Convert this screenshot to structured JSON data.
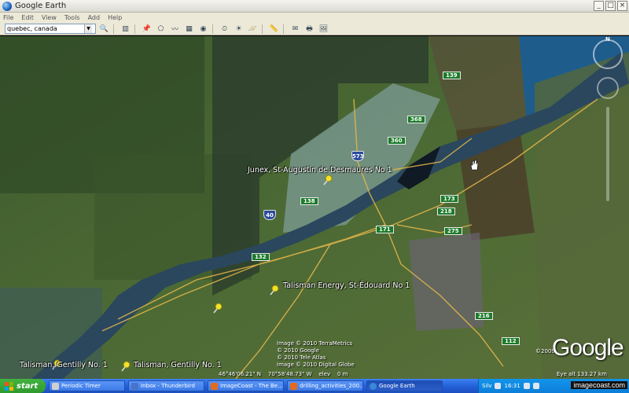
{
  "window": {
    "title": "Google Earth",
    "controls": [
      "_",
      "□",
      "×"
    ]
  },
  "menu": [
    "File",
    "Edit",
    "View",
    "Tools",
    "Add",
    "Help"
  ],
  "search": {
    "value": "quebec, canada",
    "placeholder": ""
  },
  "map": {
    "placemarks": [
      {
        "label": "Junex, St-Augustin de Desmaures No 1"
      },
      {
        "label": "Talisman Energy, St-Édouard No 1"
      },
      {
        "label": "Talisman, Gentilly No. 1"
      },
      {
        "label": "Talisman, Gentilly No. 1"
      }
    ],
    "road_shields": [
      "139",
      "368",
      "360",
      "573",
      "138",
      "40",
      "173",
      "218",
      "171",
      "275",
      "132",
      "216",
      "112"
    ],
    "credits": [
      "Image © 2010 TerraMetrics",
      "© 2010 Google",
      "© 2010 Tele Atlas",
      "Image © 2010 Digital Globe"
    ],
    "coordinates": "46°46'06.21\" N    70°58'48.73\" W    elev    0 m",
    "eye_alt": "Eye alt  133.27 km",
    "brand": "Google",
    "brand_year": "©2009"
  },
  "taskbar": {
    "start": "start",
    "tasks": [
      "Periodic Timer",
      "Inbox - Thunderbird",
      "ImageCoast - The Be...",
      "drilling_activities_200...",
      "Google Earth"
    ],
    "tray": {
      "lang": "Silv",
      "time": "16:31"
    },
    "watermark": "imagecoast.com"
  },
  "colors": {
    "road": "#e7b84a",
    "river": "#2c4a62",
    "shield_green": "#1c7b2a",
    "shield_blue": "#2c4c9c",
    "pin": "#f2e229"
  }
}
